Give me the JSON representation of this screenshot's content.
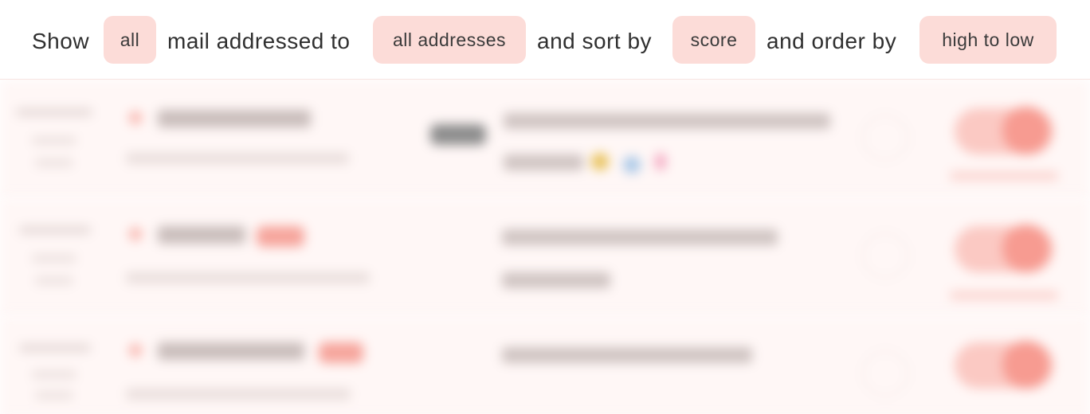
{
  "filter": {
    "show_label": "Show",
    "show_value": "all",
    "addressed_label": "mail addressed to",
    "addressed_value": "all addresses",
    "sort_label": "and sort by",
    "sort_value": "score",
    "order_label": "and order by",
    "order_value": "high to low"
  },
  "colors": {
    "pill_bg": "#fcdcd8",
    "row_bg": "#fff7f6",
    "accent": "#f79b91"
  }
}
